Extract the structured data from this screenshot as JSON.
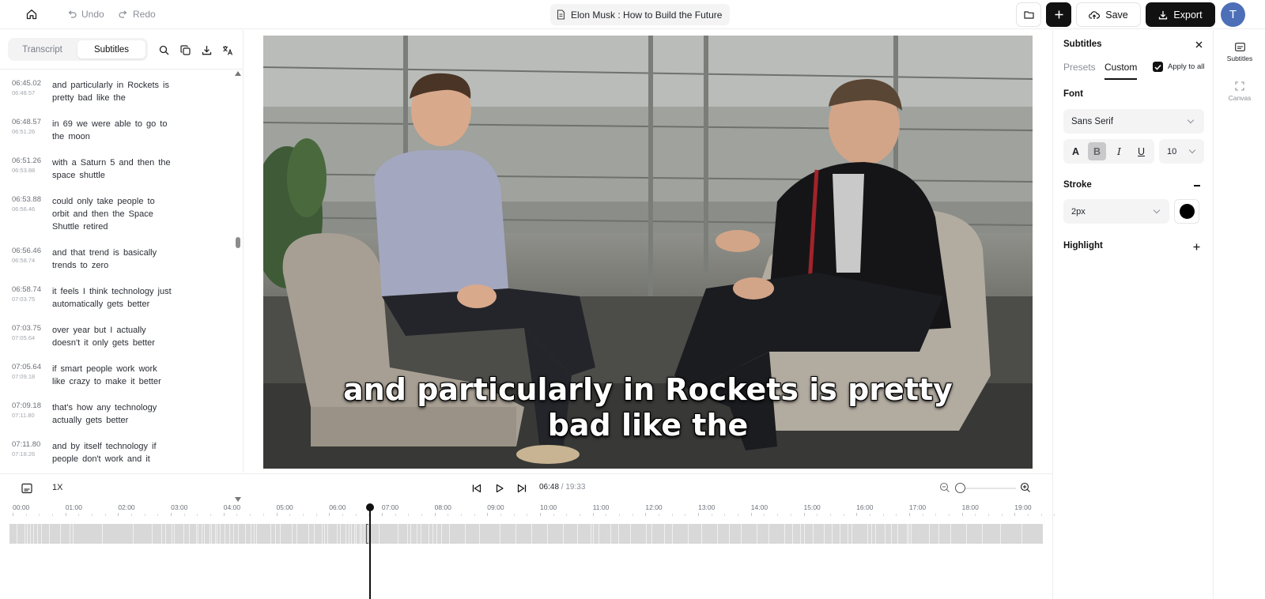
{
  "topbar": {
    "undo_label": "Undo",
    "redo_label": "Redo",
    "project_title": "Elon Musk : How to Build the Future",
    "save_label": "Save",
    "export_label": "Export",
    "avatar_initial": "T"
  },
  "left_panel": {
    "tabs": [
      {
        "label": "Transcript",
        "active": false
      },
      {
        "label": "Subtitles",
        "active": true
      }
    ],
    "subtitles": [
      {
        "start": "06:45.02",
        "end": "06:48.57",
        "text": "and particularly in Rockets is pretty bad like the"
      },
      {
        "start": "06:48.57",
        "end": "06:51.26",
        "text": "in 69 we were able to go to the moon"
      },
      {
        "start": "06:51.26",
        "end": "06:53.88",
        "text": "with a Saturn 5 and then the space shuttle"
      },
      {
        "start": "06:53.88",
        "end": "06:56.46",
        "text": "could only take people to orbit and then the Space Shuttle retired"
      },
      {
        "start": "06:56.46",
        "end": "06:58.74",
        "text": "and that trend is basically trends to zero"
      },
      {
        "start": "06:58.74",
        "end": "07:03.75",
        "text": "it feels I think technology just automatically gets better"
      },
      {
        "start": "07:03.75",
        "end": "07:05.64",
        "text": "over year but I actually doesn't it only gets better"
      },
      {
        "start": "07:05.64",
        "end": "07:09.18",
        "text": "if smart people work work like crazy to make it better"
      },
      {
        "start": "07:09.18",
        "end": "07:11.80",
        "text": "that's how any technology actually gets better"
      },
      {
        "start": "07:11.80",
        "end": "07:18.26",
        "text": "and by itself technology if people don't work and it"
      }
    ]
  },
  "video": {
    "caption": "and particularly in Rockets is pretty bad like the"
  },
  "settings": {
    "title": "Subtitles",
    "tabs": {
      "presets": "Presets",
      "custom": "Custom"
    },
    "apply_to_all": "Apply to all",
    "apply_to_all_checked": true,
    "font_label": "Font",
    "font_value": "Sans Serif",
    "style_buttons": {
      "a": "A",
      "bold": "B",
      "italic": "I",
      "underline": "U"
    },
    "bold_active": true,
    "size_value": "10",
    "stroke_label": "Stroke",
    "stroke_width": "2px",
    "stroke_color": "#000000",
    "highlight_label": "Highlight"
  },
  "rail": {
    "subtitles_label": "Subtitles",
    "canvas_label": "Canvas"
  },
  "playback": {
    "speed": "1X",
    "current_time": "06:48",
    "separator": " / ",
    "total_time": "19:33",
    "zoom_level": 0
  },
  "timeline": {
    "ticks": [
      "00:00",
      "01:00",
      "02:00",
      "03:00",
      "04:00",
      "05:00",
      "06:00",
      "07:00",
      "08:00",
      "09:00",
      "10:00",
      "11:00",
      "12:00",
      "13:00",
      "14:00",
      "15:00",
      "16:00",
      "17:00",
      "18:00",
      "19:00"
    ]
  }
}
